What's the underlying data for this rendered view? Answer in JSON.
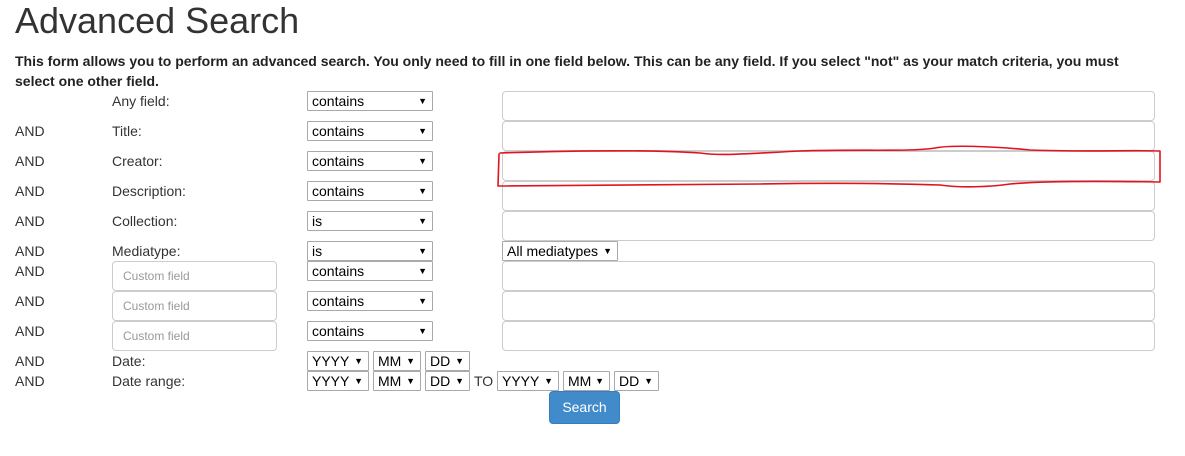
{
  "page": {
    "title": "Advanced Search",
    "intro": "This form allows you to perform an advanced search. You only need to fill in one field below. This can be any field. If you select \"not\" as your match criteria, you must select one other field."
  },
  "rows": [
    {
      "conj": "",
      "label": "Any field:",
      "match": "contains"
    },
    {
      "conj": "AND",
      "label": "Title:",
      "match": "contains"
    },
    {
      "conj": "AND",
      "label": "Creator:",
      "match": "contains"
    },
    {
      "conj": "AND",
      "label": "Description:",
      "match": "contains"
    },
    {
      "conj": "AND",
      "label": "Collection:",
      "match": "is"
    },
    {
      "conj": "AND",
      "label": "Mediatype:",
      "match": "is",
      "value": "All mediatypes"
    },
    {
      "conj": "AND",
      "placeholder": "Custom field",
      "match": "contains"
    },
    {
      "conj": "AND",
      "placeholder": "Custom field",
      "match": "contains"
    },
    {
      "conj": "AND",
      "placeholder": "Custom field",
      "match": "contains"
    },
    {
      "conj": "AND",
      "label": "Date:",
      "year": "YYYY",
      "month": "MM",
      "day": "DD"
    },
    {
      "conj": "AND",
      "label": "Date range:",
      "year": "YYYY",
      "month": "MM",
      "day": "DD",
      "to": "TO",
      "year2": "YYYY",
      "month2": "MM",
      "day2": "DD"
    }
  ],
  "search_button": "Search",
  "icons": {
    "dropdown_arrow": "▼"
  },
  "colors": {
    "button": "#428bca",
    "annotation": "#e0141e"
  }
}
